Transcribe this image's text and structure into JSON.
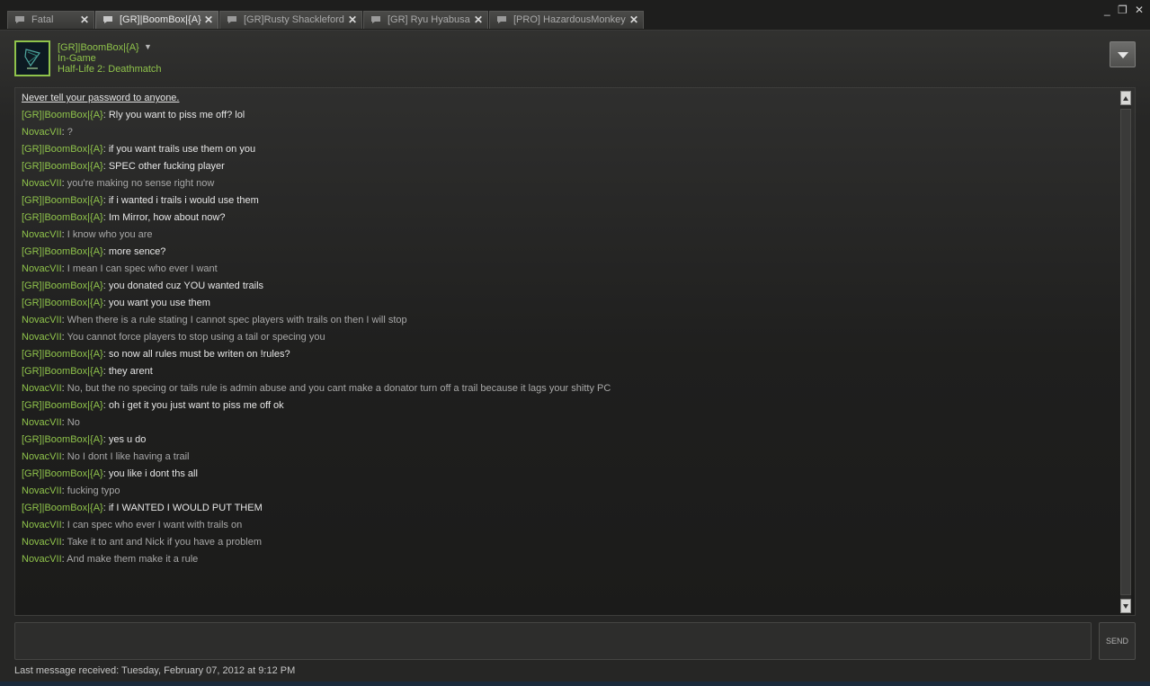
{
  "tabs": [
    {
      "label": "Fatal"
    },
    {
      "label": "[GR]|BoomBox|{A}"
    },
    {
      "label": "[GR]Rusty Shackleford"
    },
    {
      "label": "[GR] Ryu Hyabusa"
    },
    {
      "label": "[PRO] HazardousMonkey"
    }
  ],
  "header": {
    "name": "[GR]|BoomBox|{A}",
    "status": "In-Game",
    "game": "Half-Life 2: Deathmatch",
    "dropdown_glyph": "▼"
  },
  "warning": "Never tell your password to anyone.",
  "messages": [
    {
      "sender": "[GR]|BoomBox|{A}",
      "text": "Rly you want to piss me off? lol"
    },
    {
      "sender": "NovacVII",
      "text": "?"
    },
    {
      "sender": "[GR]|BoomBox|{A}",
      "text": "if you want trails use them on you"
    },
    {
      "sender": "[GR]|BoomBox|{A}",
      "text": "SPEC other fucking player"
    },
    {
      "sender": "NovacVII",
      "text": "you're making no sense right now"
    },
    {
      "sender": "[GR]|BoomBox|{A}",
      "text": "if i wanted i trails i would use them"
    },
    {
      "sender": "[GR]|BoomBox|{A}",
      "text": "Im Mirror, how about now?"
    },
    {
      "sender": "NovacVII",
      "text": "I know who you are"
    },
    {
      "sender": "[GR]|BoomBox|{A}",
      "text": "more sence?"
    },
    {
      "sender": "NovacVII",
      "text": "I mean I can spec who ever I want"
    },
    {
      "sender": "[GR]|BoomBox|{A}",
      "text": "you donated cuz YOU wanted trails"
    },
    {
      "sender": "[GR]|BoomBox|{A}",
      "text": "you want you use them"
    },
    {
      "sender": "NovacVII",
      "text": "When there is a rule stating I cannot spec players with trails on then I will stop"
    },
    {
      "sender": "NovacVII",
      "text": "You cannot force players to stop using a tail or specing you"
    },
    {
      "sender": "[GR]|BoomBox|{A}",
      "text": "so now all rules must be writen on !rules?"
    },
    {
      "sender": "[GR]|BoomBox|{A}",
      "text": "they arent"
    },
    {
      "sender": "NovacVII",
      "text": "No, but the no specing or tails rule is admin abuse and you cant make a donator turn off a trail because it lags your shitty PC"
    },
    {
      "sender": "[GR]|BoomBox|{A}",
      "text": "oh i get it you just want to piss me off ok"
    },
    {
      "sender": "NovacVII",
      "text": "No"
    },
    {
      "sender": "[GR]|BoomBox|{A}",
      "text": "yes u do"
    },
    {
      "sender": "NovacVII",
      "text": "No I dont I like having a trail"
    },
    {
      "sender": "[GR]|BoomBox|{A}",
      "text": "you like i dont ths all"
    },
    {
      "sender": "NovacVII",
      "text": "fucking typo"
    },
    {
      "sender": "[GR]|BoomBox|{A}",
      "text": "if I WANTED I WOULD PUT THEM"
    },
    {
      "sender": "NovacVII",
      "text": "I can spec who ever I want with trails on"
    },
    {
      "sender": "NovacVII",
      "text": "Take it to ant and Nick if you have a problem"
    },
    {
      "sender": "NovacVII",
      "text": "And make them make it a rule"
    }
  ],
  "send_label": "SEND",
  "status_bar": "Last message received: Tuesday, February 07, 2012 at 9:12 PM",
  "window_controls": {
    "minimize": "_",
    "restore": "❐",
    "close": "✕"
  },
  "colors": {
    "accent_green": "#8fc34b",
    "background": "#262625"
  }
}
